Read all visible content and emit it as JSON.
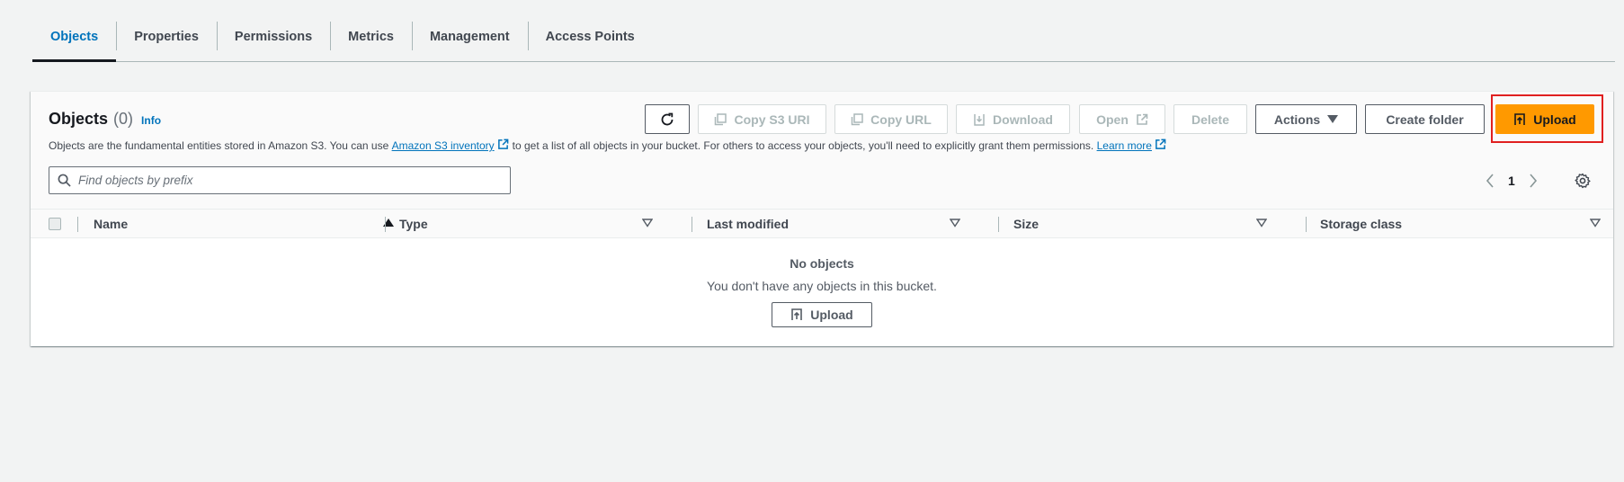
{
  "tabs": [
    {
      "label": "Objects"
    },
    {
      "label": "Properties"
    },
    {
      "label": "Permissions"
    },
    {
      "label": "Metrics"
    },
    {
      "label": "Management"
    },
    {
      "label": "Access Points"
    }
  ],
  "objects_panel": {
    "title": "Objects",
    "count": "(0)",
    "info_label": "Info",
    "description": {
      "part1": "Objects are the fundamental entities stored in Amazon S3. You can use",
      "inventory_link": "Amazon S3 inventory",
      "part2": "to get a list of all objects in your bucket. For others to access your objects, you'll need to explicitly grant them permissions.",
      "learn_more": "Learn more"
    },
    "toolbar": {
      "copy_s3_uri": "Copy S3 URI",
      "copy_url": "Copy URL",
      "download": "Download",
      "open": "Open",
      "delete": "Delete",
      "actions": "Actions",
      "create_folder": "Create folder",
      "upload": "Upload"
    },
    "search": {
      "placeholder": "Find objects by prefix",
      "value": ""
    },
    "pagination": {
      "current_page": "1"
    },
    "table": {
      "columns": [
        "Name",
        "Type",
        "Last modified",
        "Size",
        "Storage class"
      ],
      "empty_title": "No objects",
      "empty_description": "You don't have any objects in this bucket.",
      "empty_upload": "Upload"
    }
  },
  "colors": {
    "link": "#0073bb",
    "primary": "#ff9900",
    "highlight": "#e02020"
  }
}
